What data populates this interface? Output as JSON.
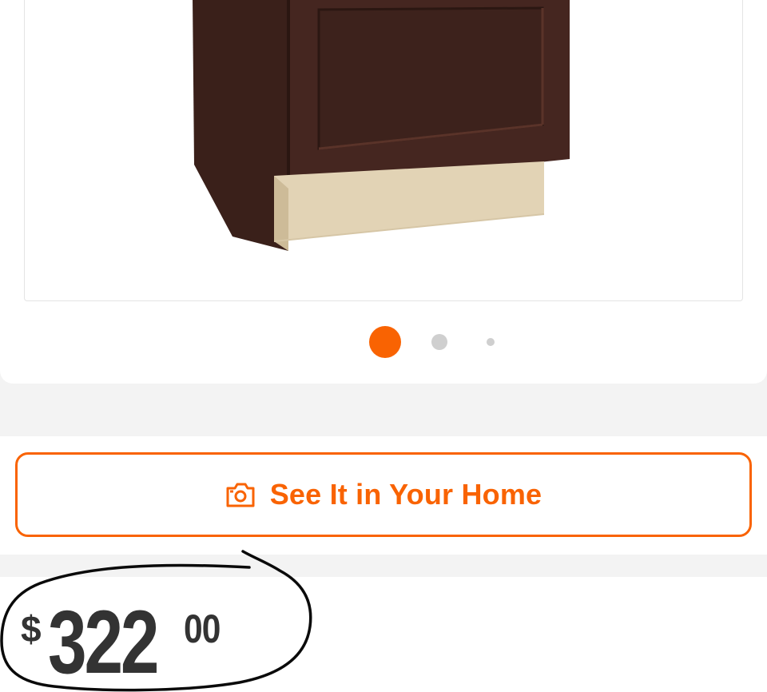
{
  "colors": {
    "accent": "#f96302",
    "text": "#333333",
    "inactive_dot": "#cfcfcf"
  },
  "gallery": {
    "image_alt": "Dark brown shaker base cabinet",
    "active_slide": 1,
    "slide_count": 3
  },
  "ar_button": {
    "icon": "camera-icon",
    "label": "See It in Your Home"
  },
  "price": {
    "currency_symbol": "$",
    "dollars": "322",
    "cents": "00"
  },
  "annotation": {
    "type": "hand-drawn circle around price",
    "color": "#000000"
  }
}
